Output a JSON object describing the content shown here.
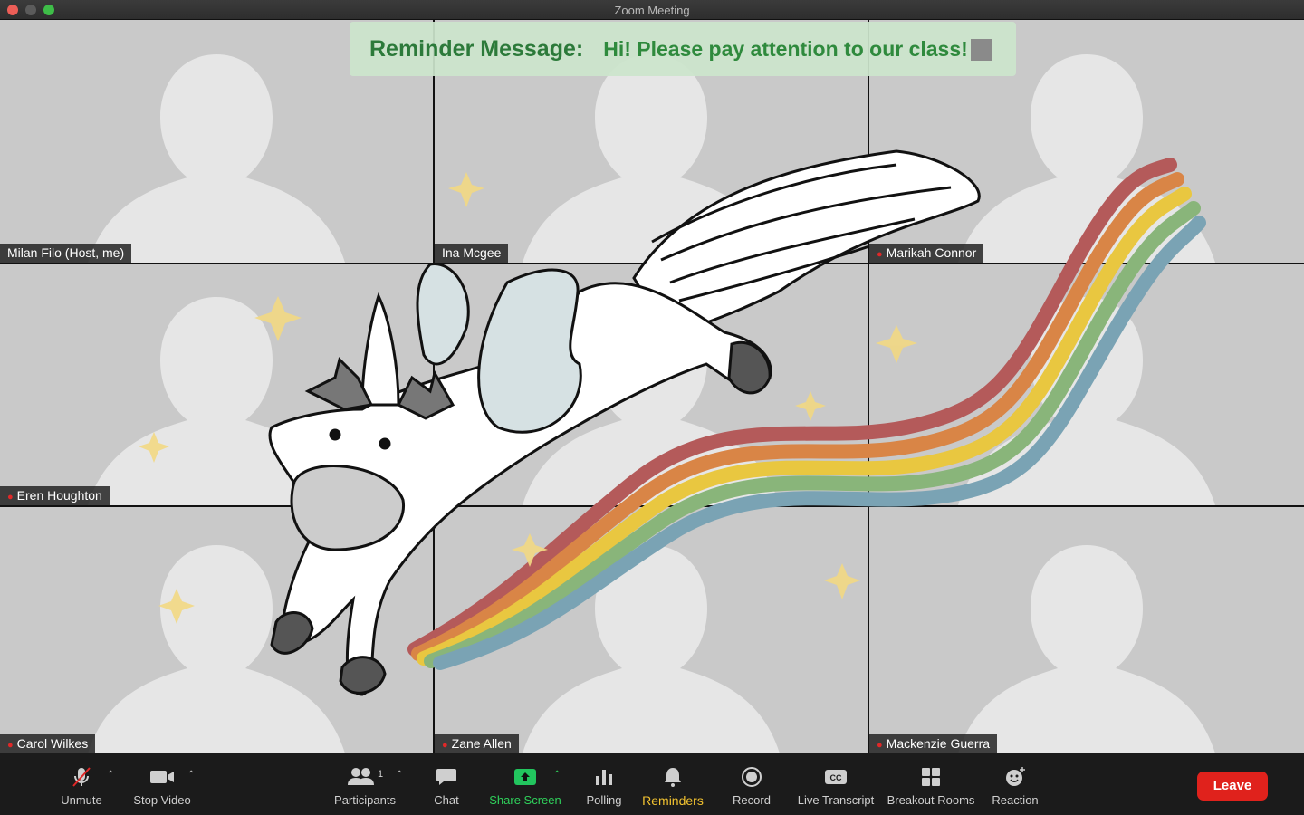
{
  "window": {
    "title": "Zoom Meeting"
  },
  "reminder": {
    "label": "Reminder Message:",
    "message": "Hi! Please pay attention to our class!"
  },
  "participants": [
    {
      "name": "Milan Filo (Host, me)",
      "muted": false
    },
    {
      "name": "Ina Mcgee",
      "muted": false
    },
    {
      "name": "Marikah Connor",
      "muted": true
    },
    {
      "name": "Eren Houghton",
      "muted": true
    },
    {
      "name": "",
      "muted": false
    },
    {
      "name": "",
      "muted": false
    },
    {
      "name": "Carol Wilkes",
      "muted": true
    },
    {
      "name": "Zane Allen",
      "muted": true
    },
    {
      "name": "Mackenzie Guerra",
      "muted": true
    }
  ],
  "toolbar": {
    "unmute": "Unmute",
    "stop_video": "Stop Video",
    "participants": "Participants",
    "participants_count": "1",
    "chat": "Chat",
    "share_screen": "Share Screen",
    "polling": "Polling",
    "reminders": "Reminders",
    "record": "Record",
    "live_transcript": "Live Transcript",
    "breakout_rooms": "Breakout Rooms",
    "reaction": "Reaction",
    "leave": "Leave"
  },
  "colors": {
    "tile_bg": "#c9c9c9",
    "silhouette": "#e6e6e6",
    "reminder_bg": "#cce5cc",
    "reminder_text": "#2c7a3a",
    "share_green": "#22c55e",
    "reminders_yellow": "#f2c230",
    "leave_red": "#e0221c"
  }
}
